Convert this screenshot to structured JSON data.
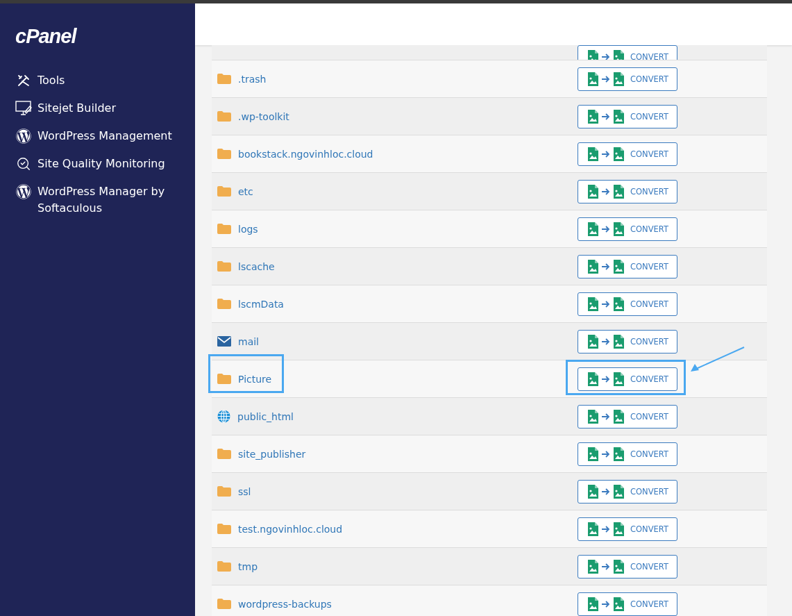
{
  "logo": "cPanel",
  "sidebar": {
    "items": [
      {
        "label": "Tools",
        "kind": "tools"
      },
      {
        "label": "Sitejet Builder",
        "kind": "monitor"
      },
      {
        "label": "WordPress Management",
        "kind": "wordpress"
      },
      {
        "label": "Site Quality Monitoring",
        "kind": "search"
      },
      {
        "label": "WordPress Manager by Softaculous",
        "kind": "wordpress"
      }
    ]
  },
  "table": {
    "rows": [
      {
        "kind": "cut",
        "action": "CONVERT",
        "highlighted": false
      },
      {
        "name": ".trash",
        "kind": "folder",
        "action": "CONVERT",
        "highlighted": false
      },
      {
        "name": ".wp-toolkit",
        "kind": "folder",
        "action": "CONVERT",
        "highlighted": false
      },
      {
        "name": "bookstack.ngovinhloc.cloud",
        "kind": "folder",
        "action": "CONVERT",
        "highlighted": false
      },
      {
        "name": "etc",
        "kind": "folder",
        "action": "CONVERT",
        "highlighted": false
      },
      {
        "name": "logs",
        "kind": "folder",
        "action": "CONVERT",
        "highlighted": false
      },
      {
        "name": "lscache",
        "kind": "folder",
        "action": "CONVERT",
        "highlighted": false
      },
      {
        "name": "lscmData",
        "kind": "folder",
        "action": "CONVERT",
        "highlighted": false
      },
      {
        "name": "mail",
        "kind": "mail",
        "action": "CONVERT",
        "highlighted": false
      },
      {
        "name": "Picture",
        "kind": "folder",
        "action": "CONVERT",
        "highlighted": true
      },
      {
        "name": "public_html",
        "kind": "globe",
        "action": "CONVERT",
        "highlighted": false
      },
      {
        "name": "site_publisher",
        "kind": "folder",
        "action": "CONVERT",
        "highlighted": false
      },
      {
        "name": "ssl",
        "kind": "folder",
        "action": "CONVERT",
        "highlighted": false
      },
      {
        "name": "test.ngovinhloc.cloud",
        "kind": "folder",
        "action": "CONVERT",
        "highlighted": false
      },
      {
        "name": "tmp",
        "kind": "folder",
        "action": "CONVERT",
        "highlighted": false
      },
      {
        "name": "wordpress-backups",
        "kind": "folder",
        "action": "CONVERT",
        "highlighted": false
      }
    ]
  }
}
